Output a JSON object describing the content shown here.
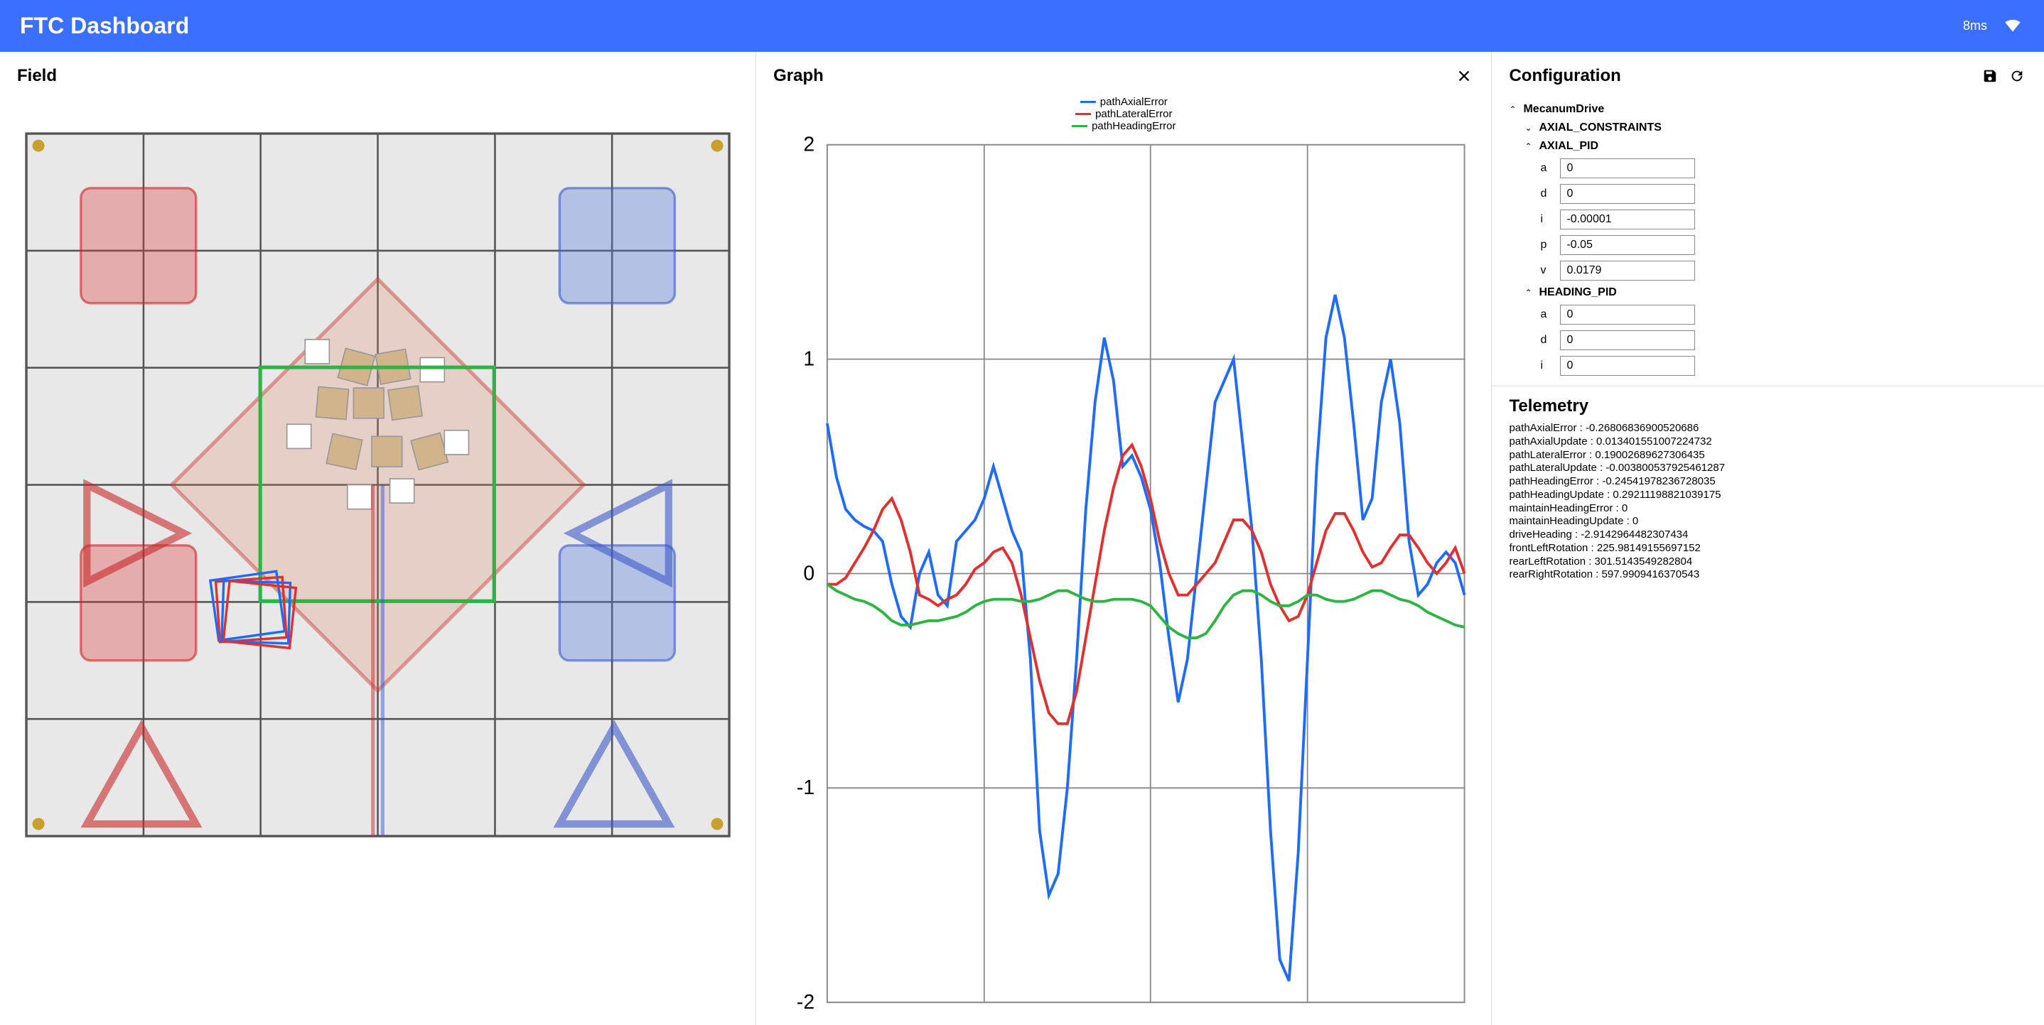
{
  "header": {
    "title": "FTC Dashboard",
    "ping": "8ms"
  },
  "panels": {
    "field": {
      "title": "Field"
    },
    "graph": {
      "title": "Graph"
    },
    "config": {
      "title": "Configuration"
    },
    "telemetry": {
      "title": "Telemetry"
    }
  },
  "config_tree": {
    "root": "MecanumDrive",
    "groups": [
      {
        "name": "AXIAL_CONSTRAINTS",
        "expanded": false
      },
      {
        "name": "AXIAL_PID",
        "expanded": true,
        "params": [
          {
            "key": "a",
            "value": "0"
          },
          {
            "key": "d",
            "value": "0"
          },
          {
            "key": "i",
            "value": "-0.00001"
          },
          {
            "key": "p",
            "value": "-0.05"
          },
          {
            "key": "v",
            "value": "0.0179"
          }
        ]
      },
      {
        "name": "HEADING_PID",
        "expanded": true,
        "params": [
          {
            "key": "a",
            "value": "0"
          },
          {
            "key": "d",
            "value": "0"
          },
          {
            "key": "i",
            "value": "0"
          }
        ]
      }
    ]
  },
  "telemetry": [
    {
      "key": "pathAxialError",
      "value": "-0.26806836900520686"
    },
    {
      "key": "pathAxialUpdate",
      "value": "0.013401551007224732"
    },
    {
      "key": "pathLateralError",
      "value": "0.19002689627306435"
    },
    {
      "key": "pathLateralUpdate",
      "value": "-0.003800537925461287"
    },
    {
      "key": "pathHeadingError",
      "value": "-0.24541978236728035"
    },
    {
      "key": "pathHeadingUpdate",
      "value": "0.29211198821039175"
    },
    {
      "key": "maintainHeadingError",
      "value": "0"
    },
    {
      "key": "maintainHeadingUpdate",
      "value": "0"
    },
    {
      "key": "driveHeading",
      "value": "-2.9142964482307434"
    },
    {
      "key": "frontLeftRotation",
      "value": "225.98149155697152"
    },
    {
      "key": "rearLeftRotation",
      "value": "301.5143549282804"
    },
    {
      "key": "rearRightRotation",
      "value": "597.9909416370543"
    }
  ],
  "chart_data": {
    "type": "line",
    "title": "",
    "xlabel": "",
    "ylabel": "",
    "ylim": [
      -2,
      2
    ],
    "x_tick_count": 5,
    "y_ticks": [
      -2,
      -1,
      0,
      1,
      2
    ],
    "legend": [
      "pathAxialError",
      "pathLateralError",
      "pathHeadingError"
    ],
    "colors": {
      "pathAxialError": "#1f6bff",
      "pathLateralError": "#e03131",
      "pathHeadingError": "#2fb344"
    },
    "series": [
      {
        "name": "pathAxialError",
        "values": [
          0.7,
          0.45,
          0.3,
          0.25,
          0.22,
          0.2,
          0.15,
          -0.05,
          -0.2,
          -0.25,
          0.0,
          0.1,
          -0.1,
          -0.15,
          0.15,
          0.2,
          0.25,
          0.35,
          0.5,
          0.35,
          0.2,
          0.1,
          -0.4,
          -1.2,
          -1.5,
          -1.4,
          -1.0,
          -0.4,
          0.3,
          0.8,
          1.1,
          0.9,
          0.5,
          0.55,
          0.45,
          0.3,
          0.05,
          -0.3,
          -0.6,
          -0.4,
          0.0,
          0.4,
          0.8,
          0.9,
          1.0,
          0.6,
          0.2,
          -0.4,
          -1.2,
          -1.8,
          -1.9,
          -1.3,
          -0.4,
          0.5,
          1.1,
          1.3,
          1.1,
          0.7,
          0.25,
          0.35,
          0.8,
          1.0,
          0.7,
          0.15,
          -0.1,
          -0.05,
          0.05,
          0.1,
          0.05,
          -0.1
        ]
      },
      {
        "name": "pathLateralError",
        "values": [
          -0.05,
          -0.05,
          -0.02,
          0.05,
          0.12,
          0.2,
          0.3,
          0.35,
          0.25,
          0.1,
          -0.1,
          -0.12,
          -0.15,
          -0.12,
          -0.1,
          -0.05,
          0.02,
          0.05,
          0.1,
          0.12,
          0.05,
          -0.1,
          -0.3,
          -0.5,
          -0.65,
          -0.7,
          -0.7,
          -0.55,
          -0.3,
          -0.05,
          0.2,
          0.4,
          0.55,
          0.6,
          0.5,
          0.35,
          0.15,
          0.0,
          -0.1,
          -0.1,
          -0.05,
          0.0,
          0.05,
          0.15,
          0.25,
          0.25,
          0.2,
          0.1,
          -0.05,
          -0.15,
          -0.22,
          -0.2,
          -0.1,
          0.05,
          0.2,
          0.28,
          0.28,
          0.2,
          0.1,
          0.03,
          0.05,
          0.12,
          0.18,
          0.18,
          0.12,
          0.05,
          0.0,
          0.05,
          0.12,
          0.0
        ]
      },
      {
        "name": "pathHeadingError",
        "values": [
          -0.05,
          -0.08,
          -0.1,
          -0.12,
          -0.13,
          -0.15,
          -0.18,
          -0.22,
          -0.24,
          -0.24,
          -0.23,
          -0.22,
          -0.22,
          -0.21,
          -0.2,
          -0.18,
          -0.15,
          -0.13,
          -0.12,
          -0.12,
          -0.12,
          -0.13,
          -0.13,
          -0.12,
          -0.1,
          -0.08,
          -0.08,
          -0.1,
          -0.12,
          -0.13,
          -0.13,
          -0.12,
          -0.12,
          -0.12,
          -0.13,
          -0.15,
          -0.2,
          -0.25,
          -0.28,
          -0.3,
          -0.3,
          -0.28,
          -0.22,
          -0.15,
          -0.1,
          -0.08,
          -0.08,
          -0.1,
          -0.13,
          -0.15,
          -0.15,
          -0.13,
          -0.1,
          -0.1,
          -0.12,
          -0.13,
          -0.13,
          -0.12,
          -0.1,
          -0.08,
          -0.08,
          -0.1,
          -0.12,
          -0.13,
          -0.15,
          -0.18,
          -0.2,
          -0.22,
          -0.24,
          -0.25
        ]
      }
    ]
  }
}
